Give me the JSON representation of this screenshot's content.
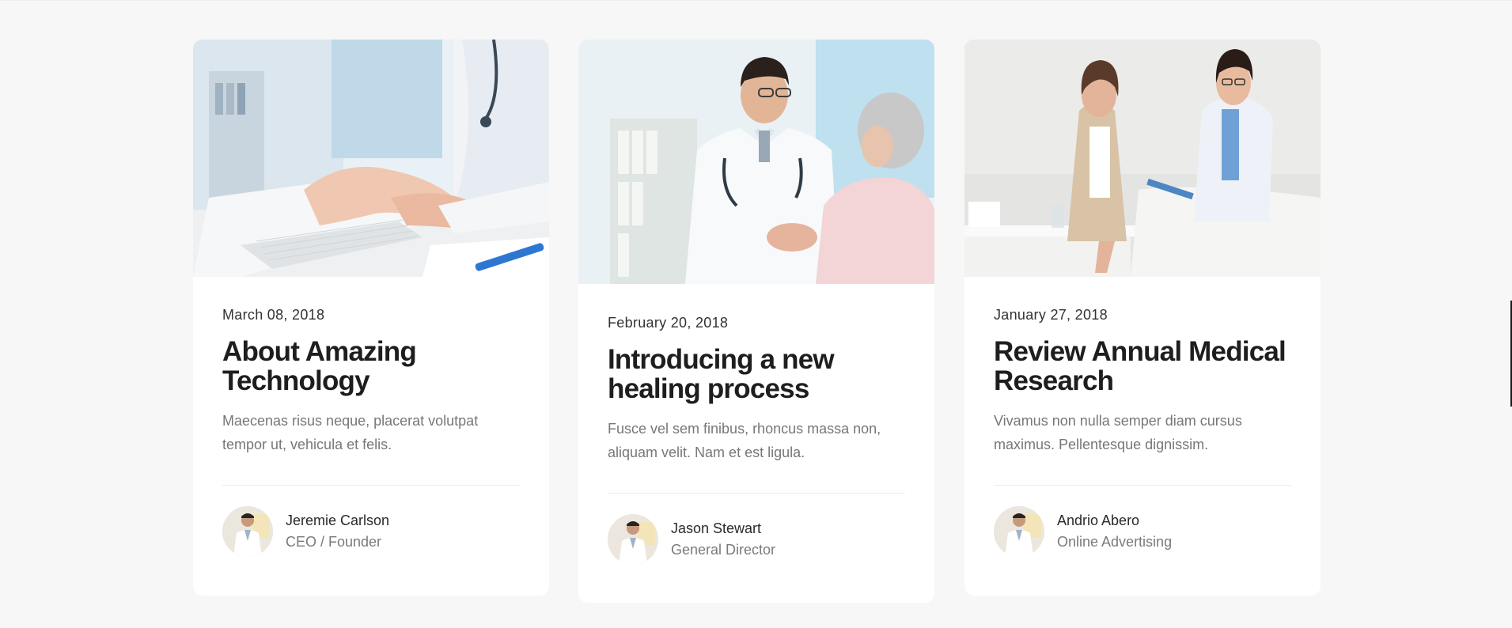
{
  "posts": [
    {
      "date": "March 08, 2018",
      "title": "About Amazing Technology",
      "excerpt": "Maecenas risus neque, placerat volutpat tempor ut, vehicula et felis.",
      "author_name": "Jeremie Carlson",
      "author_role": "CEO / Founder"
    },
    {
      "date": "February 20, 2018",
      "title": "Introducing a new healing process",
      "excerpt": "Fusce vel sem finibus, rhoncus massa non, aliquam velit. Nam et est ligula.",
      "author_name": "Jason Stewart",
      "author_role": "General Director"
    },
    {
      "date": "January 27, 2018",
      "title": "Review Annual Medical Research",
      "excerpt": "Vivamus non nulla semper diam cursus maximus. Pellentesque dignissim.",
      "author_name": "Andrio Abero",
      "author_role": "Online Advertising"
    }
  ],
  "colors": {
    "page_background": "#f7f7f7",
    "card_background": "#ffffff",
    "title_text": "#1e1e1e",
    "muted_text": "#777777"
  }
}
